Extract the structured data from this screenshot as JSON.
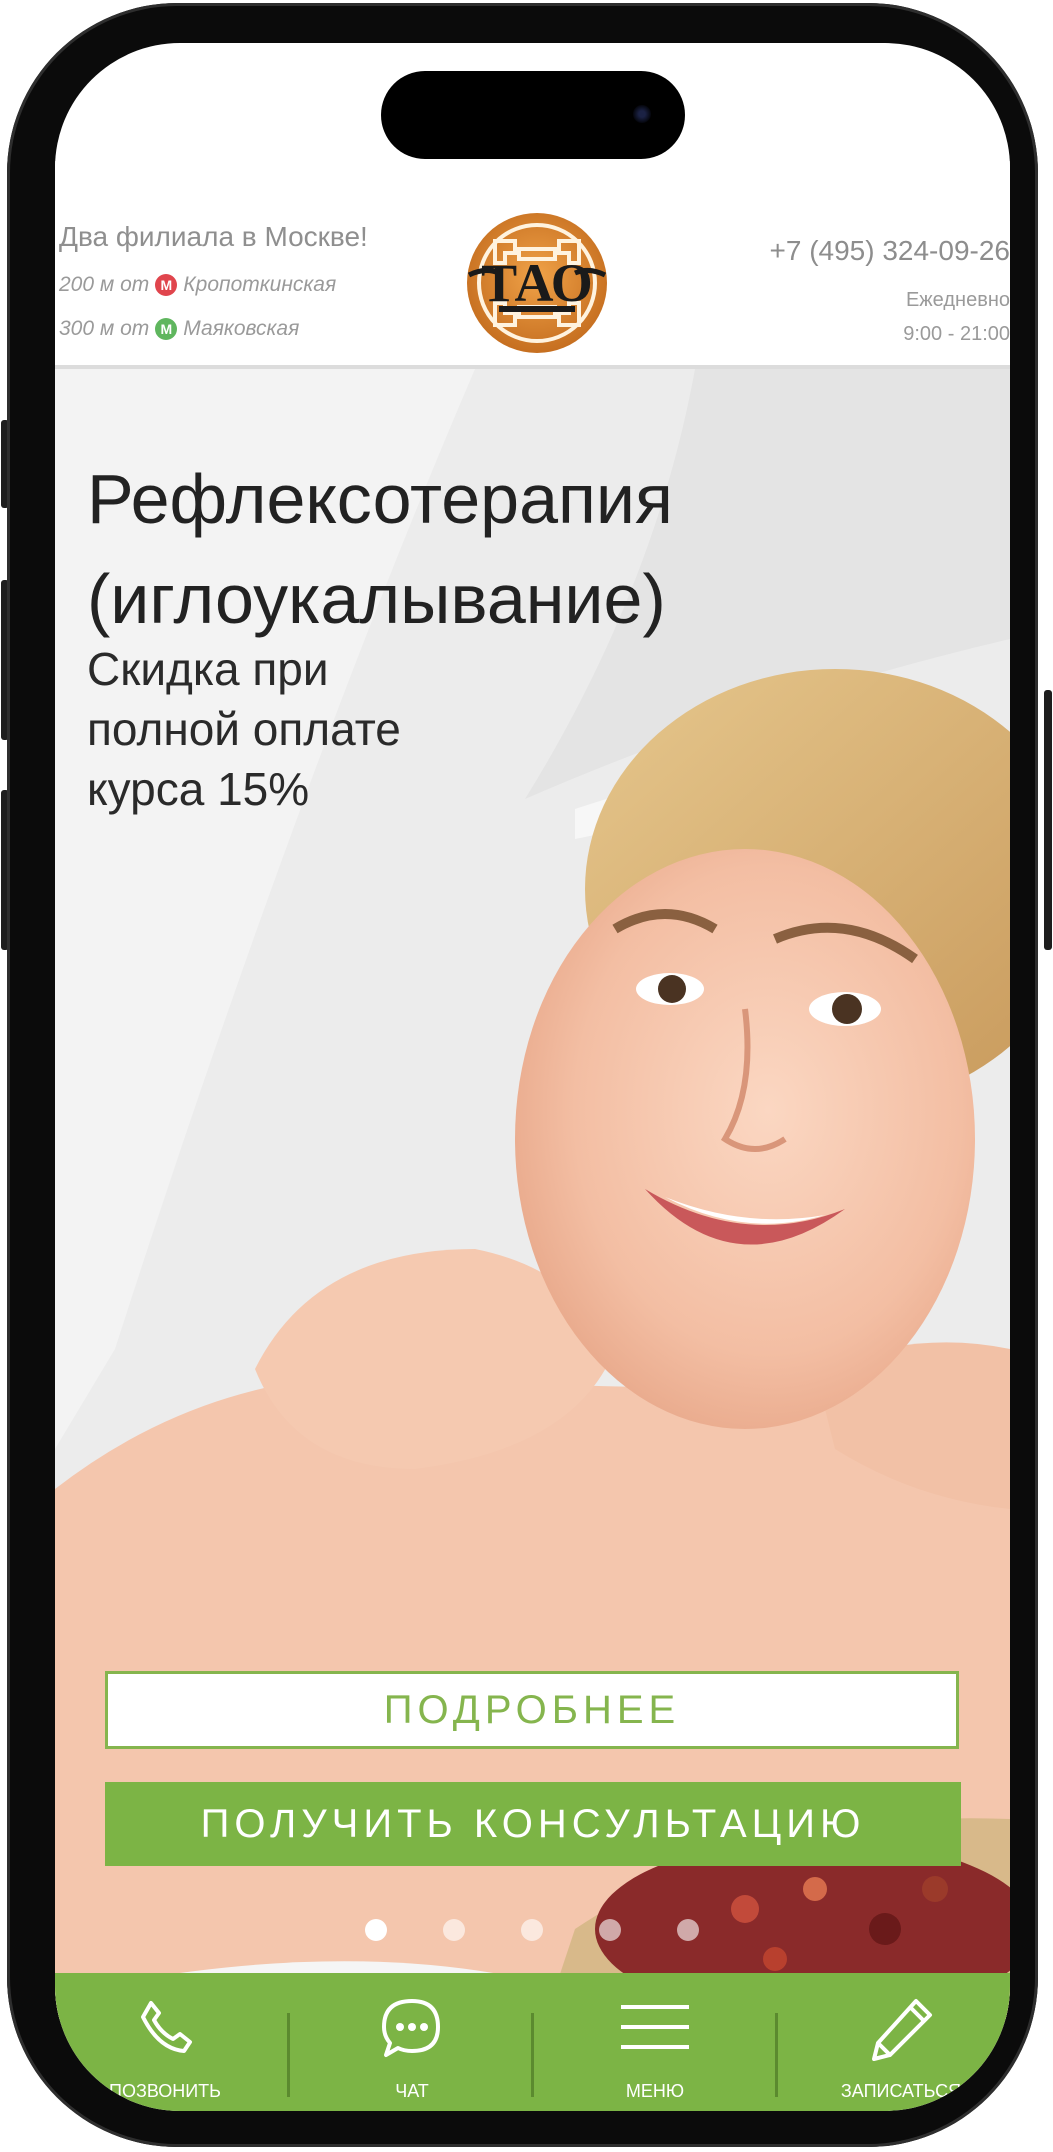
{
  "header": {
    "branches_title": "Два филиала в Москве!",
    "metro": [
      {
        "distance": "200 м от",
        "station": "Кропоткинская",
        "line_letter": "М",
        "line_color": "#e0454d"
      },
      {
        "distance": "300 м от",
        "station": "Маяковская",
        "line_letter": "М",
        "line_color": "#5fb65e"
      }
    ],
    "logo_text": "ТАО",
    "phone": "+7 (495) 324-09-26",
    "hours_label": "Ежедневно",
    "hours_time": "9:00 - 21:00"
  },
  "hero": {
    "title_line1": "Рефлексотерапия",
    "title_line2": "(иглоукалывание)",
    "subtitle_line1": "Скидка при",
    "subtitle_line2": "полной оплате",
    "subtitle_line3": "курса 15%",
    "more_button": "ПОДРОБНЕЕ",
    "consult_button": "ПОЛУЧИТЬ КОНСУЛЬТАЦИЮ",
    "slides_total": 5,
    "active_slide": 1
  },
  "bottom_nav": {
    "items": [
      {
        "label": "ПОЗВОНИТЬ",
        "icon": "phone-icon"
      },
      {
        "label": "ЧАТ",
        "icon": "chat-icon"
      },
      {
        "label": "МЕНЮ",
        "icon": "menu-icon"
      },
      {
        "label": "ЗАПИСАТЬСЯ",
        "icon": "pencil-icon"
      }
    ]
  },
  "colors": {
    "accent_green": "#7cb445",
    "logo_orange": "#d9822b",
    "text_gray": "#8f8f8f"
  }
}
